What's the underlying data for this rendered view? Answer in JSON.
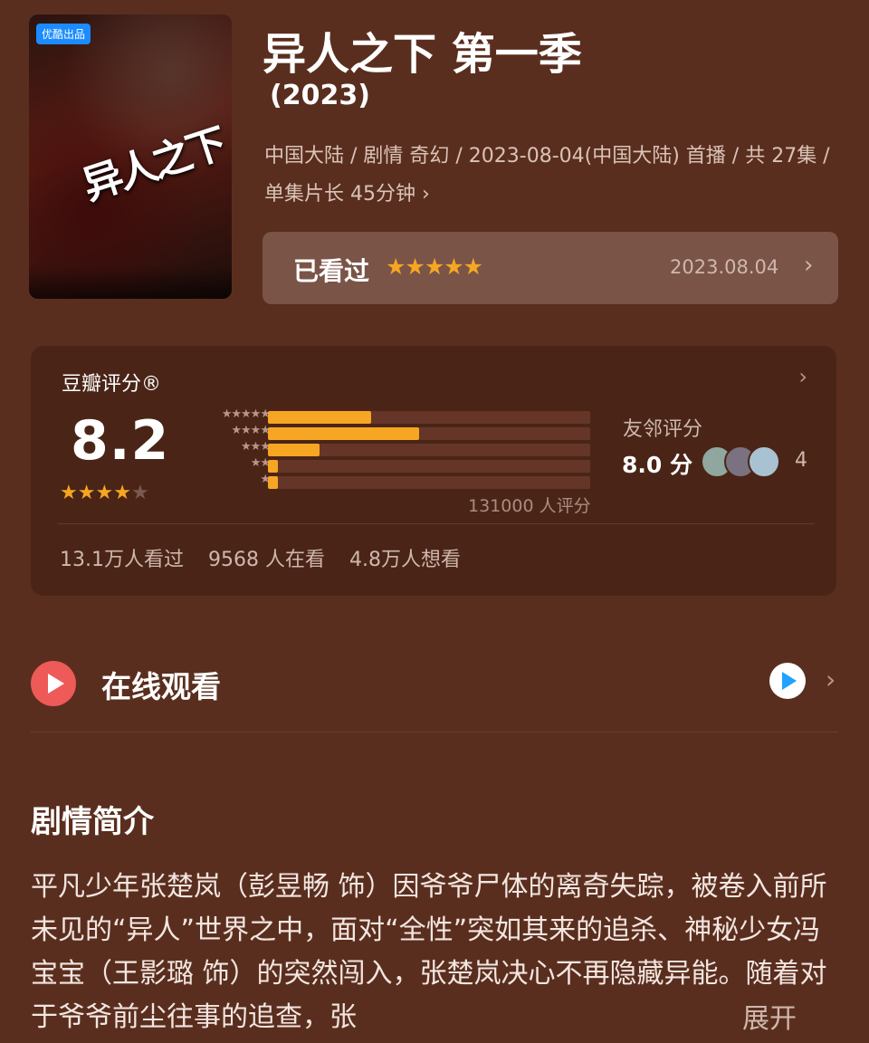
{
  "poster": {
    "badge": "优酷出品",
    "logo_text": "异人之下"
  },
  "header": {
    "title": "异人之下 第一季",
    "year": "(2023)",
    "meta_line": "中国大陆 / 剧情 奇幻 / 2023-08-04(中国大陆) 首播 / 共 27集 / 单集片长 45分钟",
    "meta_chevron": "›"
  },
  "watched": {
    "label": "已看过",
    "stars": "★★★★★",
    "date": "2023.08.04",
    "chevron": "›"
  },
  "rating": {
    "title": "豆瓣评分®",
    "chevron": "›",
    "score": "8.2",
    "score_star_fraction": 0.8,
    "distribution": [
      {
        "stars": "★★★★★",
        "fraction": 0.32
      },
      {
        "stars": "★★★★",
        "fraction": 0.47
      },
      {
        "stars": "★★★",
        "fraction": 0.16
      },
      {
        "stars": "★★",
        "fraction": 0.03
      },
      {
        "stars": "★",
        "fraction": 0.03
      }
    ],
    "count": "131000 人评分",
    "neighbor_label": "友邻评分",
    "neighbor_score": "8.0 分",
    "neighbor_count": "4",
    "stats": [
      "13.1万人看过",
      "9568 人在看",
      "4.8万人想看"
    ]
  },
  "online": {
    "label": "在线观看",
    "chevron": "›"
  },
  "synopsis": {
    "title": "剧情简介",
    "text": "平凡少年张楚岚（彭昱畅 饰）因爷爷尸体的离奇失踪，被卷入前所未见的“异人”世界之中，面对“全性”突如其来的追杀、神秘少女冯宝宝（王影璐 饰）的突然闯入，张楚岚决心不再隐藏异能。随着对于爷爷前尘往事的追查，张",
    "more": "展开"
  },
  "colors": {
    "background": "#5a2e1e",
    "card": "#4a2517",
    "accent_star": "#f6a623",
    "play_red": "#ee5a58"
  }
}
